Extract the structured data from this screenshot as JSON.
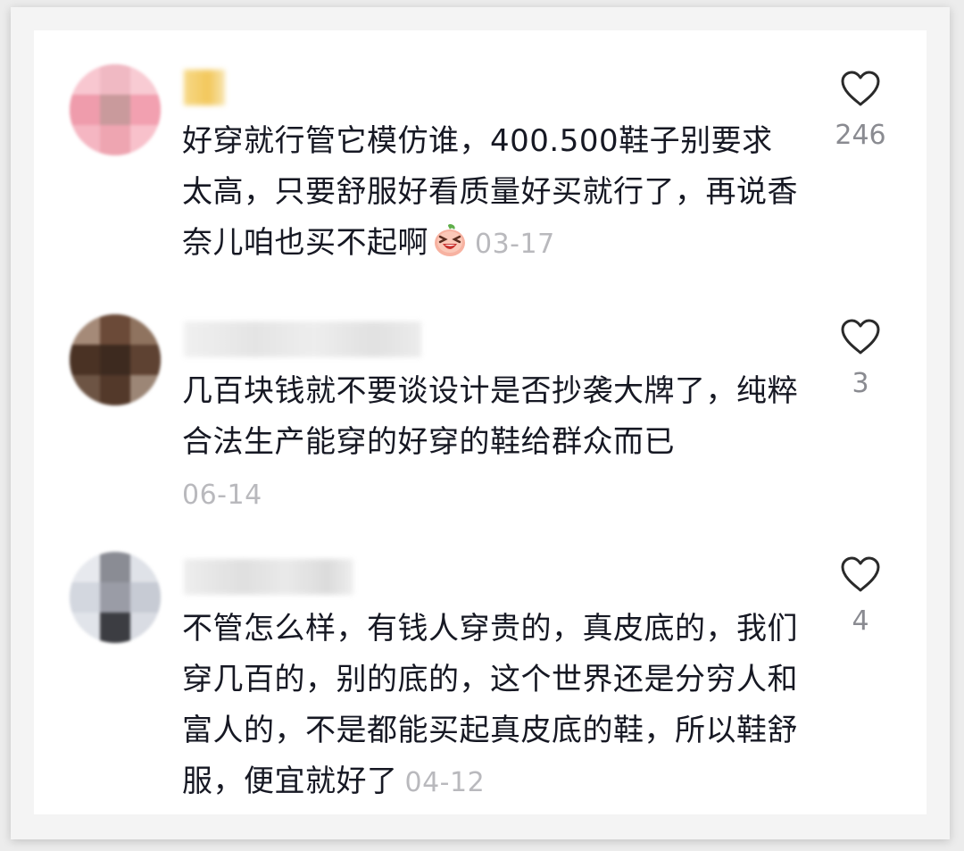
{
  "comments": [
    {
      "text": "好穿就行管它模仿谁，400.500鞋子别要求太高，只要舒服好看质量好买就行了，再说香奈儿咱也买不起啊",
      "date": "03-17",
      "likes": "246",
      "emoji": "laughing-peach-emoji"
    },
    {
      "text": "几百块钱就不要谈设计是否抄袭大牌了，纯粹合法生产能穿的好穿的鞋给群众而已",
      "date": "06-14",
      "likes": "3"
    },
    {
      "text": "不管怎么样，有钱人穿贵的，真皮底的，我们穿几百的，别的底的，这个世界还是分穷人和富人的，不是都能买起真皮底的鞋，所以鞋舒服，便宜就好了",
      "date": "04-12",
      "likes": "4"
    }
  ],
  "icons": {
    "like": "heart-outline-icon"
  },
  "colors": {
    "text": "#161823",
    "date": "#b9b9bd",
    "count": "#8a8b91",
    "heart": "#2a2a2a"
  }
}
